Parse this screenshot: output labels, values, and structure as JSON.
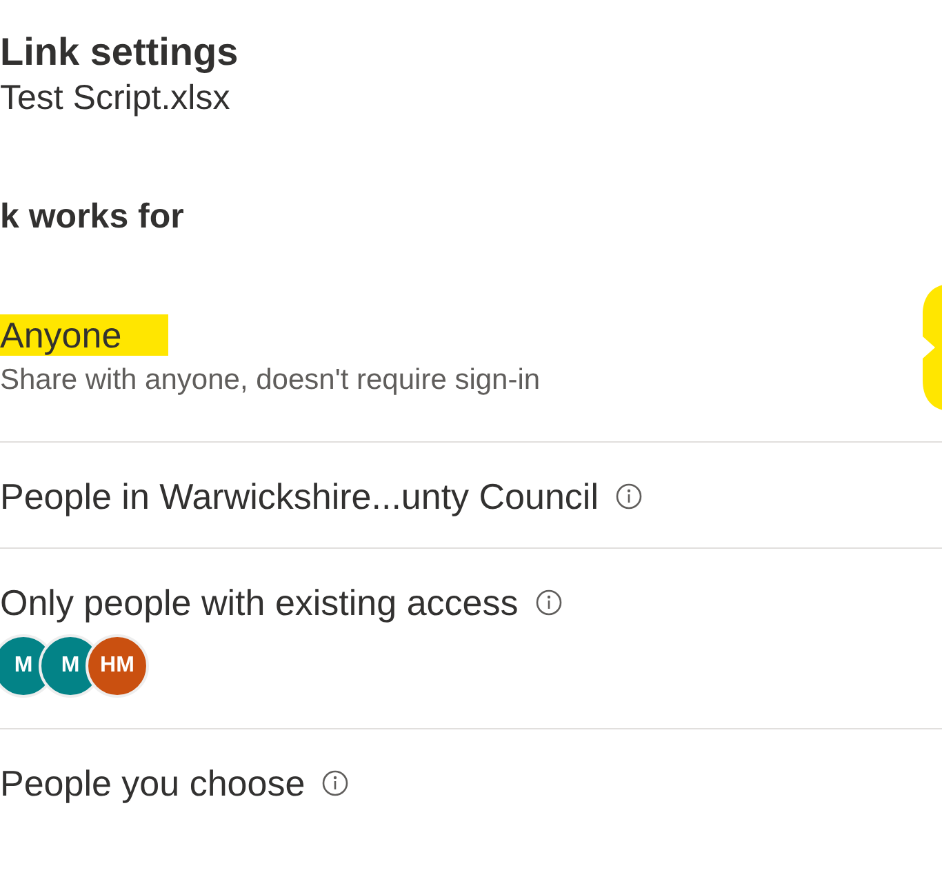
{
  "title": "Link settings",
  "file_name": "Test Script.xlsx",
  "section_heading": "k works for",
  "options": [
    {
      "label": "Anyone",
      "highlighted": true,
      "description": "Share with anyone, doesn't require sign-in",
      "info": false,
      "selected": true
    },
    {
      "label": "People in Warwickshire...unty Council",
      "highlighted": false,
      "info": true,
      "selected": false
    },
    {
      "label": "Only people with existing access",
      "highlighted": false,
      "info": true,
      "selected": false,
      "avatars": [
        {
          "initials": "M",
          "color": "#038387"
        },
        {
          "initials": "M",
          "color": "#038387"
        },
        {
          "initials": "HM",
          "color": "#ca5010"
        }
      ]
    },
    {
      "label": "People you choose",
      "highlighted": false,
      "info": true,
      "selected": false
    }
  ]
}
